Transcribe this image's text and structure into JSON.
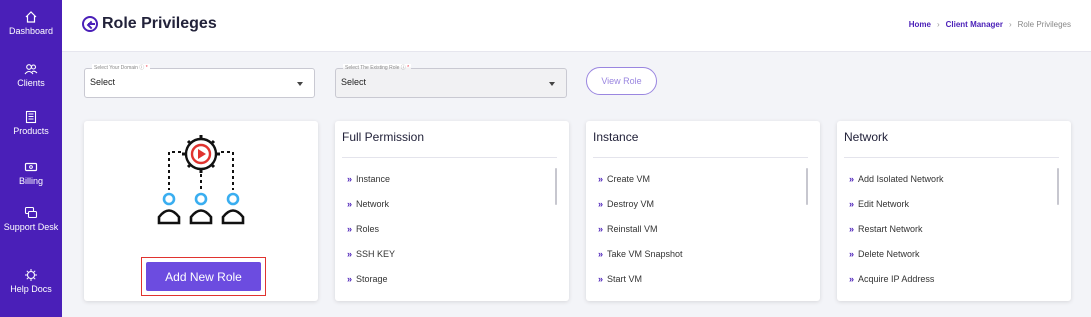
{
  "sidebar": {
    "items": [
      {
        "label": "Dashboard",
        "icon": "home-icon"
      },
      {
        "label": "Clients",
        "icon": "users-icon"
      },
      {
        "label": "Products",
        "icon": "products-icon"
      },
      {
        "label": "Billing",
        "icon": "billing-icon"
      },
      {
        "label": "Support Desk",
        "icon": "support-icon"
      },
      {
        "label": "Help Docs",
        "icon": "help-icon"
      }
    ]
  },
  "header": {
    "title": "Role Privileges",
    "breadcrumb": [
      "Home",
      "Client Manager",
      "Role Privileges"
    ]
  },
  "filters": {
    "domain": {
      "label": "Select Your Domain",
      "value": "Select"
    },
    "role": {
      "label": "Select The Existing Role",
      "value": "Select"
    },
    "view_label": "View Role"
  },
  "add_role": {
    "label": "Add New Role"
  },
  "cards": [
    {
      "title": "Full Permission",
      "items": [
        "Instance",
        "Network",
        "Roles",
        "SSH KEY",
        "Storage"
      ]
    },
    {
      "title": "Instance",
      "items": [
        "Create VM",
        "Destroy VM",
        "Reinstall VM",
        "Take VM Snapshot",
        "Start VM"
      ]
    },
    {
      "title": "Network",
      "items": [
        "Add Isolated Network",
        "Edit Network",
        "Restart Network",
        "Delete Network",
        "Acquire IP Address"
      ]
    }
  ],
  "colors": {
    "brand": "#4a1fb8",
    "button": "#6c4ce0",
    "highlight": "#e0332f"
  }
}
